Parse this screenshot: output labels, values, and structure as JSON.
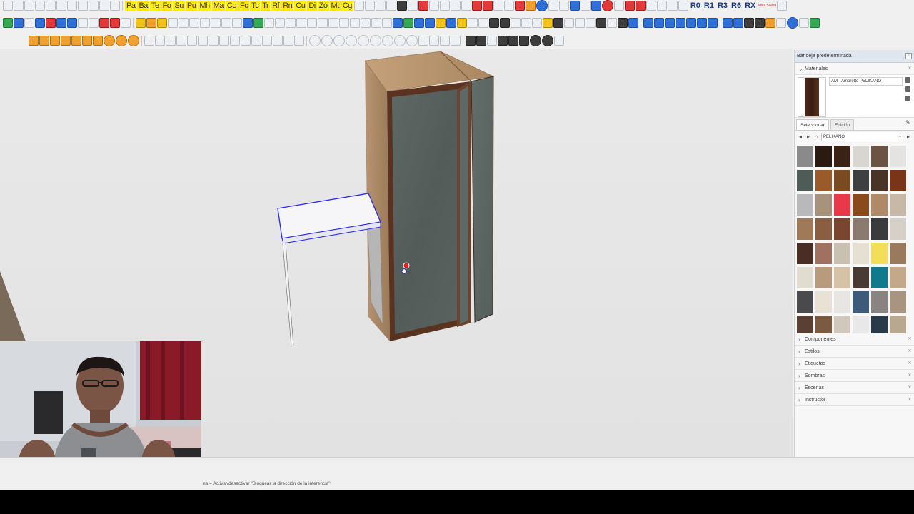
{
  "toolbar_top": {
    "ruby_shortcuts": [
      "Pa",
      "Ba",
      "Te",
      "Fo",
      "Su",
      "Pu",
      "Mh",
      "Ma",
      "Co",
      "Fc",
      "Tc",
      "Tr",
      "Rf",
      "Rn",
      "Cu",
      "Di",
      "Zó",
      "Mt",
      "Cg"
    ],
    "rotation_buttons": [
      "R0",
      "R1",
      "R3",
      "R6",
      "RX"
    ],
    "small_labels": [
      "Vista",
      "Sólida"
    ]
  },
  "tray": {
    "title": "Bandeja predeterminada",
    "materials": {
      "section_label": "Materiales",
      "current_material": "AM - Amaretto PELIKANO",
      "tab_select": "Seleccionar",
      "tab_edit": "Edición",
      "library": "PELIKANO",
      "swatches": [
        "#8a8a8a",
        "#2b1a12",
        "#3a2216",
        "#d9d5d0",
        "#6b5443",
        "#e5e3e1",
        "#4f5b57",
        "#9a5a2a",
        "#7a4a22",
        "#3e3f41",
        "#4a3428",
        "#7a3418",
        "#b9b9bb",
        "#a8927c",
        "#e8384a",
        "#8a4a1c",
        "#b08a66",
        "#c8b8a8",
        "#a07a58",
        "#8a5e40",
        "#7a4630",
        "#8a7a70",
        "#3a3b3d",
        "#d6d0c8",
        "#4a2e26",
        "#a07060",
        "#c8c0b0",
        "#e6e0d2",
        "#f2de58",
        "#9a7a5c",
        "#e0dcd0",
        "#b89a7c",
        "#d6c2a6",
        "#4a3a34",
        "#0e7a8c",
        "#c4a88a",
        "#4a4a4c",
        "#e8e2d4",
        "#e8e6e2",
        "#3e5a7a",
        "#8a8480",
        "#a89480",
        "#5a4034",
        "#7a5a40",
        "#d0c8bc",
        "#e8e8e8",
        "#2a3a48",
        "#b8a890"
      ]
    },
    "sections": [
      "Componentes",
      "Estilos",
      "Etiquetas",
      "Sombras",
      "Escenas",
      "Instructor"
    ]
  },
  "status": {
    "text": "na = Activar/desactivar \"Bloquear la dirección de la inferencia\"."
  },
  "colors": {
    "background": "#f0f0f0",
    "selection_blue": "#2222ee",
    "cabinet_wood_top": "#b0906a",
    "cabinet_panel": "#5a6460"
  }
}
